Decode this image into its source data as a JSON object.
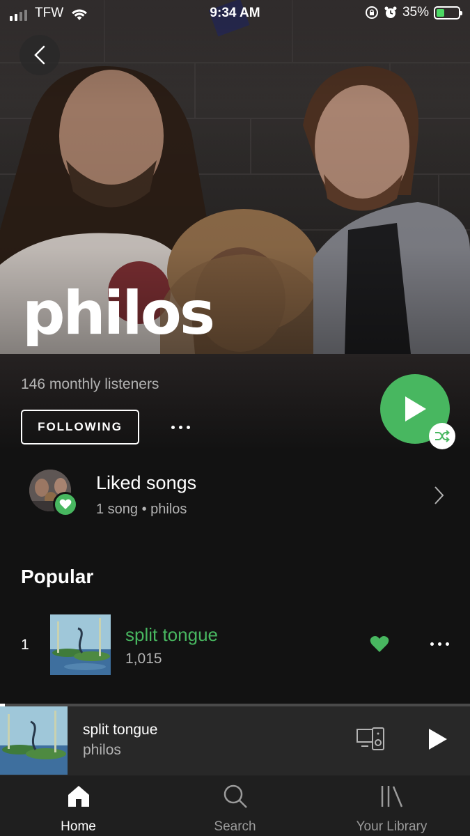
{
  "status_bar": {
    "carrier": "TFW",
    "time": "9:34 AM",
    "battery": "35%"
  },
  "artist": {
    "name": "philos",
    "monthly_listeners": "146 monthly listeners",
    "follow_label": "FOLLOWING"
  },
  "liked_songs": {
    "title": "Liked songs",
    "subtitle": "1 song • philos"
  },
  "popular": {
    "heading": "Popular",
    "tracks": [
      {
        "rank": "1",
        "title": "split tongue",
        "plays": "1,015",
        "liked": true
      }
    ]
  },
  "now_playing": {
    "title": "split tongue",
    "artist": "philos",
    "progress": 0.01
  },
  "tab_bar": {
    "tabs": [
      {
        "label": "Home",
        "icon": "home-icon",
        "active": true
      },
      {
        "label": "Search",
        "icon": "search-icon",
        "active": false
      },
      {
        "label": "Your Library",
        "icon": "library-icon",
        "active": false
      }
    ]
  },
  "colors": {
    "accent_green": "#48b760",
    "background": "#121212",
    "secondary_text": "#b3b3b3"
  }
}
